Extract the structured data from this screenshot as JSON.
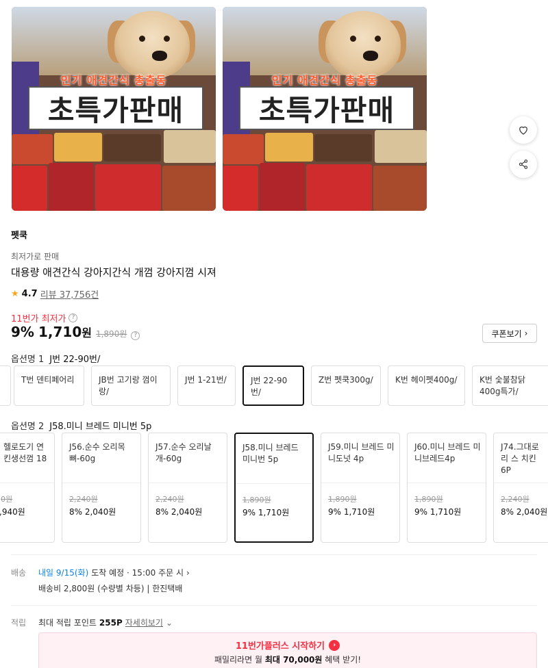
{
  "images": [
    {
      "sub": "인기 애견간식 총출동",
      "banner": "초특가판매"
    },
    {
      "sub": "인기 애견간식 총출동",
      "banner": "초특가판매"
    }
  ],
  "actions": {
    "like_icon": "heart-icon",
    "share_icon": "share-icon"
  },
  "seller": "펫쿡",
  "lowest_sale": "최저가로 판매",
  "title": "대용량 애견간식 강아지간식 개껌 강아지껌 시져",
  "rating": {
    "star": "★",
    "score": "4.7",
    "reviews": "리뷰 37,756건"
  },
  "price": {
    "lowest_label": "11번가 최저가",
    "help": "?",
    "discount": "9%",
    "sale": "1,710",
    "won": "원",
    "original": "1,890원"
  },
  "coupon": {
    "label": "쿠폰보기",
    "arrow": "›"
  },
  "option1": {
    "label": "옵션명 1",
    "value": "J번 22-90번/",
    "items": [
      "T번 덴티페어리",
      "JB번 고기랑 껌이랑/",
      "J번 1-21번/",
      "J번 22-90번/",
      "Z번 펫쿡300g/",
      "K번 헤이펫400g/",
      "K번 숯불참닭400g특가/"
    ]
  },
  "option2": {
    "label": "옵션명 2",
    "value": "J58.미니 브레드 미니번 5p",
    "items": [
      {
        "name": "헬로도기 연 킨생선껌 18",
        "orig": "0원",
        "sale": ",940원"
      },
      {
        "name": "J56.순수 오리목뼈-60g",
        "orig": "2,240원",
        "sale": "8% 2,040원"
      },
      {
        "name": "J57.순수 오리날개-60g",
        "orig": "2,240원",
        "sale": "8% 2,040원"
      },
      {
        "name": "J58.미니 브레드 미니번 5p",
        "orig": "1,890원",
        "sale": "9% 1,710원"
      },
      {
        "name": "J59.미니 브레드 미니도넛 4p",
        "orig": "1,890원",
        "sale": "9% 1,710원"
      },
      {
        "name": "J60.미니 브레드 미니브레드4p",
        "orig": "1,890원",
        "sale": "9% 1,710원"
      },
      {
        "name": "J74.그대로리 스 치킨6P",
        "orig": "2,240원",
        "sale": "8% 2,040원"
      }
    ]
  },
  "shipping": {
    "label": "배송",
    "arrival_date": "내일 9/15(화)",
    "arrival_text": "도착 예정 · 15:00 주문 시",
    "arrow": "›",
    "fee": "배송비 2,800원 (수량별 차등) | 한진택배"
  },
  "points": {
    "label": "적립",
    "text": "최대 적립 포인트",
    "value": "255P",
    "more": "자세히보기",
    "more_icon": "⌄"
  },
  "promo": {
    "title": "11번가플러스 시작하기",
    "go": "›",
    "line_pre": "패밀리라면 월",
    "line_bold": "최대 70,000원",
    "line_post": "혜택 받기!"
  },
  "colors": {
    "accent": "#f43142",
    "blue": "#0b83e6",
    "star": "#f5a623"
  }
}
